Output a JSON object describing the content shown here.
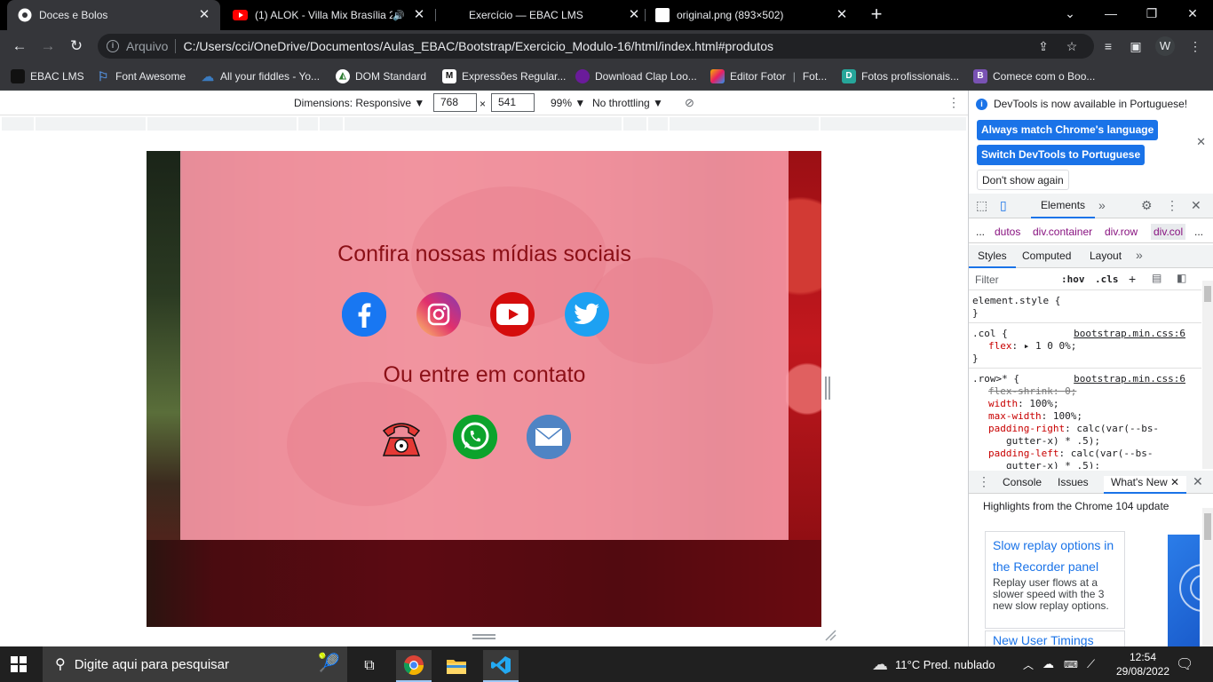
{
  "browser": {
    "tabs": [
      {
        "title": "Doces e Bolos",
        "active": true,
        "icon": "chrome-icon"
      },
      {
        "title": "(1) ALOK - Villa Mix Brasília 2",
        "active": false,
        "icon": "youtube-icon",
        "audio": true
      },
      {
        "title": "Exercício — EBAC LMS",
        "active": false,
        "icon": "ebac-icon"
      },
      {
        "title": "original.png (893×502)",
        "active": false,
        "icon": "image-icon"
      }
    ],
    "address": {
      "scheme_label": "Arquivo",
      "url": "C:/Users/cci/OneDrive/Documentos/Aulas_EBAC/Bootstrap/Exercicio_Modulo-16/html/index.html#produtos"
    },
    "profile_initial": "W",
    "bookmarks": [
      {
        "label": "EBAC LMS",
        "color": "#1a1a1a"
      },
      {
        "label": "Font Awesome",
        "color": "#538dd7"
      },
      {
        "label": "All your fiddles - Yo...",
        "color": "#3b7bbf"
      },
      {
        "label": "DOM Standard",
        "color": "#2e7d32"
      },
      {
        "label": "Expressões Regular...",
        "color": "#111111"
      },
      {
        "label": "Download Clap Loo...",
        "color": "#6a1b9a"
      },
      {
        "label": "Editor Fotor",
        "color": "#f4b400"
      },
      {
        "label": "Fot...",
        "color": ""
      },
      {
        "label": "Fotos profissionais...",
        "color": "#26a69a"
      },
      {
        "label": "Comece com o Boo...",
        "color": "#7952b3"
      }
    ]
  },
  "device_toolbar": {
    "dimensions_label": "Dimensions: Responsive",
    "width": "768",
    "height": "541",
    "times": "×",
    "zoom": "99%",
    "throttling": "No throttling"
  },
  "page": {
    "heading_social": "Confira nossas mídias sociais",
    "heading_contact": "Ou entre em contato",
    "social_icons": [
      "facebook-icon",
      "instagram-icon",
      "youtube-icon",
      "twitter-icon"
    ],
    "contact_icons": [
      "telephone-icon",
      "whatsapp-icon",
      "email-icon"
    ]
  },
  "devtools": {
    "banner_text": "DevTools is now available in Portuguese!",
    "btn_match": "Always match Chrome's language",
    "btn_switch": "Switch DevTools to Portuguese",
    "btn_dont_show": "Don't show again",
    "panel_tab": "Elements",
    "breadcrumbs": [
      "...",
      "dutos",
      "div.container",
      "div.row",
      "div.col",
      "..."
    ],
    "subtabs": [
      "Styles",
      "Computed",
      "Layout"
    ],
    "filter_placeholder": "Filter",
    "hov": ":hov",
    "cls": ".cls",
    "styles": {
      "element_style": "element.style {",
      "close_brace": "}",
      "rule1_selector": ".col {",
      "rule1_src": "bootstrap.min.css:6",
      "rule1_prop": "flex",
      "rule1_val": "1 0 0%;",
      "rule2_selector": ".row>* {",
      "rule2_src": "bootstrap.min.css:6",
      "rule2_props": [
        {
          "prop": "flex-shrink",
          "val": "0;",
          "struck": true
        },
        {
          "prop": "width",
          "val": "100%;"
        },
        {
          "prop": "max-width",
          "val": "100%;"
        },
        {
          "prop": "padding-right",
          "val": "calc(var(--bs-"
        },
        {
          "prop": "",
          "val": "gutter-x) * .5);"
        },
        {
          "prop": "padding-left",
          "val": "calc(var(--bs-"
        },
        {
          "prop": "",
          "val": "gutter-x) * .5);"
        }
      ]
    },
    "drawer_tabs": [
      "Console",
      "Issues",
      "What's New"
    ],
    "whats_new_heading": "Highlights from the Chrome 104 update",
    "card_title": "Slow replay options in the Recorder panel",
    "card_body": "Replay user flows at a slower speed with the 3 new slow replay options.",
    "card2_title": "New User Timings"
  },
  "taskbar": {
    "search_placeholder": "Digite aqui para pesquisar",
    "weather": "11°C  Pred. nublado",
    "time": "12:54",
    "date": "29/08/2022"
  }
}
